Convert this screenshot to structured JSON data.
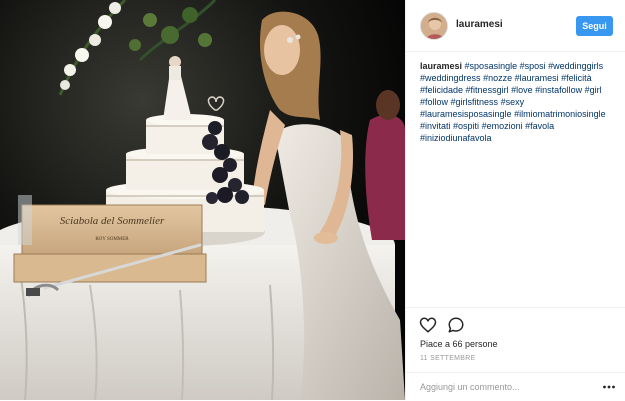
{
  "post": {
    "username": "lauramesi",
    "follow_label": "Segui",
    "caption_author": "lauramesi",
    "hashtags": [
      "#sposasingle",
      "#sposi",
      "#weddinggirls",
      "#weddingdress",
      "#nozze",
      "#lauramesi",
      "#felicità",
      "#felicidade",
      "#fitnessgirl",
      "#love",
      "#instafollow",
      "#girl",
      "#follow",
      "#girlsfitness",
      "#sexy",
      "#lauramesisposasingle",
      "#ilmiomatrimoniosingle",
      "#invitati",
      "#ospiti",
      "#emozioni",
      "#favola",
      "#iniziodiunafavola"
    ],
    "likes_text": "Piace a 66 persone",
    "date": "11 SETTEMBRE",
    "comment_placeholder": "Aggiungi un commento...",
    "icons": {
      "like": "heart-icon",
      "comment": "comment-bubble-icon",
      "more": "more-dots-icon"
    },
    "photo": {
      "box_text_line1": "Sciabola del Sommelier",
      "box_text_line2": "ROY SOMMER"
    },
    "colors": {
      "follow_button": "#3897f0",
      "hashtag": "#003569",
      "muted": "#999999",
      "border": "#efefef"
    }
  }
}
